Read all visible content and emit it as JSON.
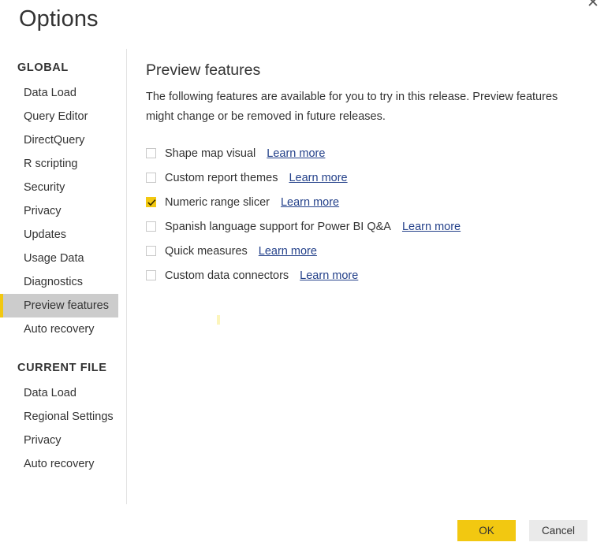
{
  "window": {
    "title": "Options",
    "close_label": "✕"
  },
  "sidebar": {
    "groups": [
      {
        "title": "GLOBAL",
        "items": [
          {
            "label": "Data Load",
            "selected": false
          },
          {
            "label": "Query Editor",
            "selected": false
          },
          {
            "label": "DirectQuery",
            "selected": false
          },
          {
            "label": "R scripting",
            "selected": false
          },
          {
            "label": "Security",
            "selected": false
          },
          {
            "label": "Privacy",
            "selected": false
          },
          {
            "label": "Updates",
            "selected": false
          },
          {
            "label": "Usage Data",
            "selected": false
          },
          {
            "label": "Diagnostics",
            "selected": false
          },
          {
            "label": "Preview features",
            "selected": true
          },
          {
            "label": "Auto recovery",
            "selected": false
          }
        ]
      },
      {
        "title": "CURRENT FILE",
        "items": [
          {
            "label": "Data Load",
            "selected": false
          },
          {
            "label": "Regional Settings",
            "selected": false
          },
          {
            "label": "Privacy",
            "selected": false
          },
          {
            "label": "Auto recovery",
            "selected": false
          }
        ]
      }
    ]
  },
  "main": {
    "heading": "Preview features",
    "description": "The following features are available for you to try in this release. Preview features might change or be removed in future releases.",
    "learn_more_label": "Learn more",
    "features": [
      {
        "label": "Shape map visual",
        "checked": false
      },
      {
        "label": "Custom report themes",
        "checked": false
      },
      {
        "label": "Numeric range slicer",
        "checked": true
      },
      {
        "label": "Spanish language support for Power BI Q&A",
        "checked": false
      },
      {
        "label": "Quick measures",
        "checked": false
      },
      {
        "label": "Custom data connectors",
        "checked": false
      }
    ]
  },
  "footer": {
    "ok_label": "OK",
    "cancel_label": "Cancel"
  },
  "colors": {
    "accent": "#f2c811",
    "link": "#24418a",
    "selected_bg": "#cccccc",
    "cancel_bg": "#eaeaea",
    "text": "#333333"
  }
}
